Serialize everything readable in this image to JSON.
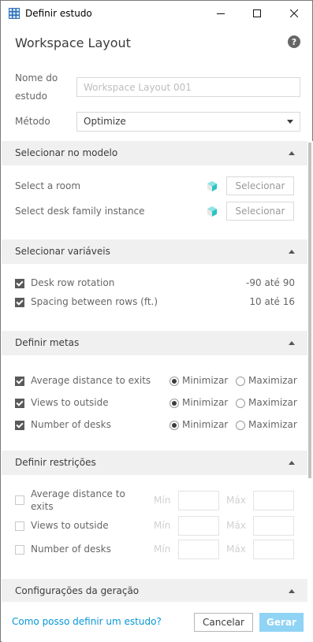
{
  "window": {
    "title": "Definir estudo",
    "minimize_icon": "minimize-icon",
    "maximize_icon": "maximize-icon",
    "close_icon": "close-icon"
  },
  "header": {
    "title": "Workspace Layout",
    "help_icon": "help-icon"
  },
  "form": {
    "study_name_label": "Nome do estudo",
    "study_name_label_line1": "Nome do",
    "study_name_label_line2": "estudo",
    "study_name_placeholder": "Workspace Layout 001",
    "study_name_value": "",
    "method_label": "Método",
    "method_value": "Optimize"
  },
  "sections": {
    "select_model": {
      "title": "Selecionar no modelo",
      "rows": [
        {
          "label": "Select a room",
          "button": "Selecionar"
        },
        {
          "label": "Select desk family instance",
          "button": "Selecionar"
        }
      ]
    },
    "variables": {
      "title": "Selecionar variáveis",
      "rows": [
        {
          "label": "Desk row rotation",
          "range": "-90 até 90",
          "checked": true
        },
        {
          "label": "Spacing between rows (ft.)",
          "range": "10 até 16",
          "checked": true
        }
      ]
    },
    "goals": {
      "title": "Definir metas",
      "option_min": "Minimizar",
      "option_max": "Maximizar",
      "rows": [
        {
          "label": "Average distance to exits",
          "checked": true,
          "selected": "Minimizar"
        },
        {
          "label": "Views to outside",
          "checked": true,
          "selected": "Minimizar"
        },
        {
          "label": "Number of desks",
          "checked": true,
          "selected": "Minimizar"
        }
      ]
    },
    "constraints": {
      "title": "Definir restrições",
      "min_label": "Mín",
      "max_label": "Máx",
      "rows": [
        {
          "label_line1": "Average distance to",
          "label_line2": "exits",
          "checked": false
        },
        {
          "label": "Views to outside",
          "checked": false
        },
        {
          "label": "Number of desks",
          "checked": false
        }
      ]
    },
    "generation": {
      "title": "Configurações da geração"
    }
  },
  "footer": {
    "help_link": "Como posso definir um estudo?",
    "cancel_label": "Cancelar",
    "generate_label": "Gerar"
  },
  "colors": {
    "accent": "#0696d7",
    "primary_button_disabled": "#8fd3f5",
    "section_header_bg": "#f0f0f0",
    "cube_icon": "#2bc3c3"
  }
}
